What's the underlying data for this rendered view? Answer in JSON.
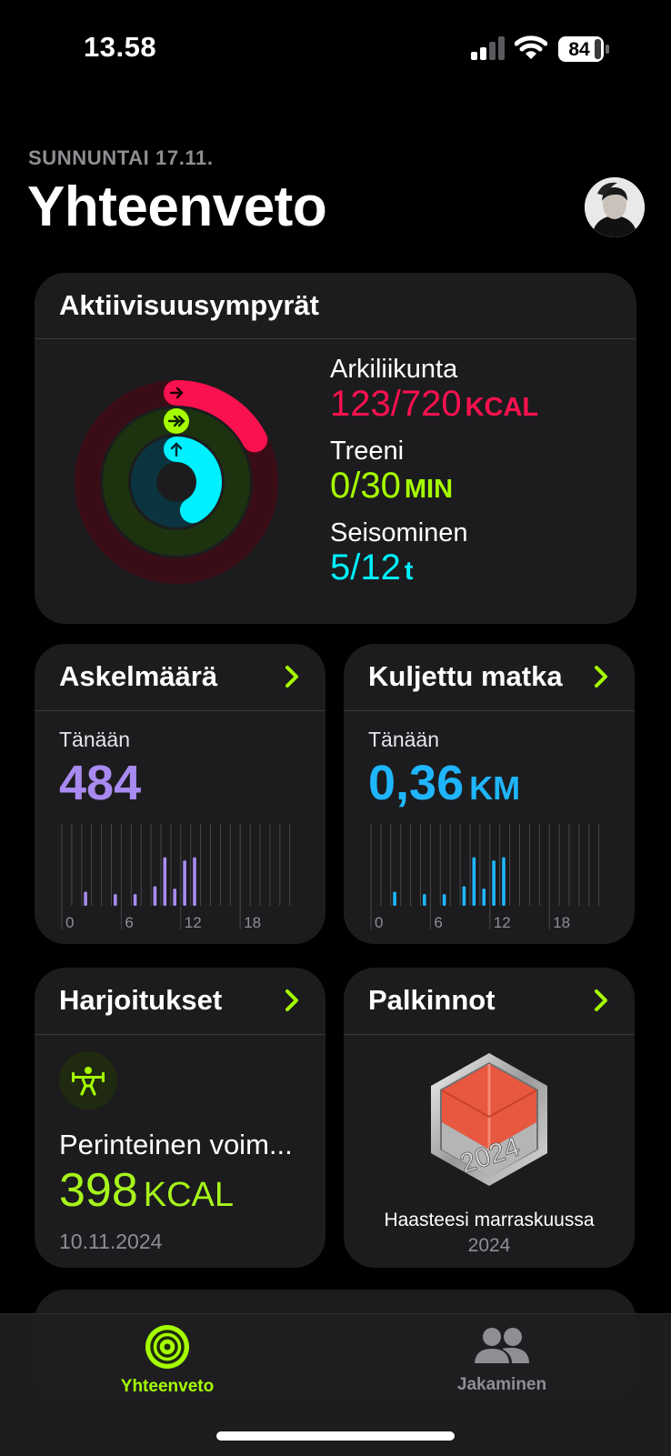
{
  "status": {
    "time": "13.58",
    "battery": "84"
  },
  "header": {
    "date": "SUNNUNTAI 17.11.",
    "title": "Yhteenveto"
  },
  "rings_card": {
    "title": "Aktiivisuusympyrät",
    "move": {
      "label": "Arkiliikunta",
      "value": "123/720",
      "unit": "KCAL",
      "color": "#fa114f",
      "progress": 0.171
    },
    "exercise": {
      "label": "Treeni",
      "value": "0/30",
      "unit": "MIN",
      "color": "#a6ff00",
      "progress": 0
    },
    "stand": {
      "label": "Seisominen",
      "value": "5/12",
      "unit": "t",
      "color": "#00f0ff",
      "progress": 0.417
    }
  },
  "steps_card": {
    "title": "Askelmäärä",
    "today_label": "Tänään",
    "value": "484",
    "color": "#a98af0",
    "axis_labels": [
      "0",
      "6",
      "12",
      "18"
    ],
    "hourly_fraction": [
      0,
      0,
      0.18,
      0,
      0,
      0.15,
      0,
      0.15,
      0,
      0.25,
      0.62,
      0.22,
      0.58,
      0.62,
      0,
      0,
      0,
      0,
      0,
      0,
      0,
      0,
      0,
      0
    ]
  },
  "distance_card": {
    "title": "Kuljettu matka",
    "today_label": "Tänään",
    "value": "0,36",
    "unit": "KM",
    "color": "#1fb6ff",
    "axis_labels": [
      "0",
      "6",
      "12",
      "18"
    ],
    "hourly_fraction": [
      0,
      0,
      0.18,
      0,
      0,
      0.15,
      0,
      0.15,
      0,
      0.25,
      0.62,
      0.22,
      0.58,
      0.62,
      0,
      0,
      0,
      0,
      0,
      0,
      0,
      0,
      0,
      0
    ]
  },
  "workouts_card": {
    "title": "Harjoitukset",
    "icon": "weightlifting-icon",
    "name": "Perinteinen voim...",
    "value": "398",
    "unit": "KCAL",
    "date": "10.11.2024"
  },
  "awards_card": {
    "title": "Palkinnot",
    "badge_year": "2024",
    "line1": "Haasteesi marraskuussa",
    "line2": "2024"
  },
  "tabs": [
    {
      "label": "Yhteenveto",
      "icon": "activity-rings-icon",
      "active": true,
      "color": "#a6ff00"
    },
    {
      "label": "Jakaminen",
      "icon": "people-icon",
      "active": false,
      "color": "#8e8e93"
    }
  ]
}
